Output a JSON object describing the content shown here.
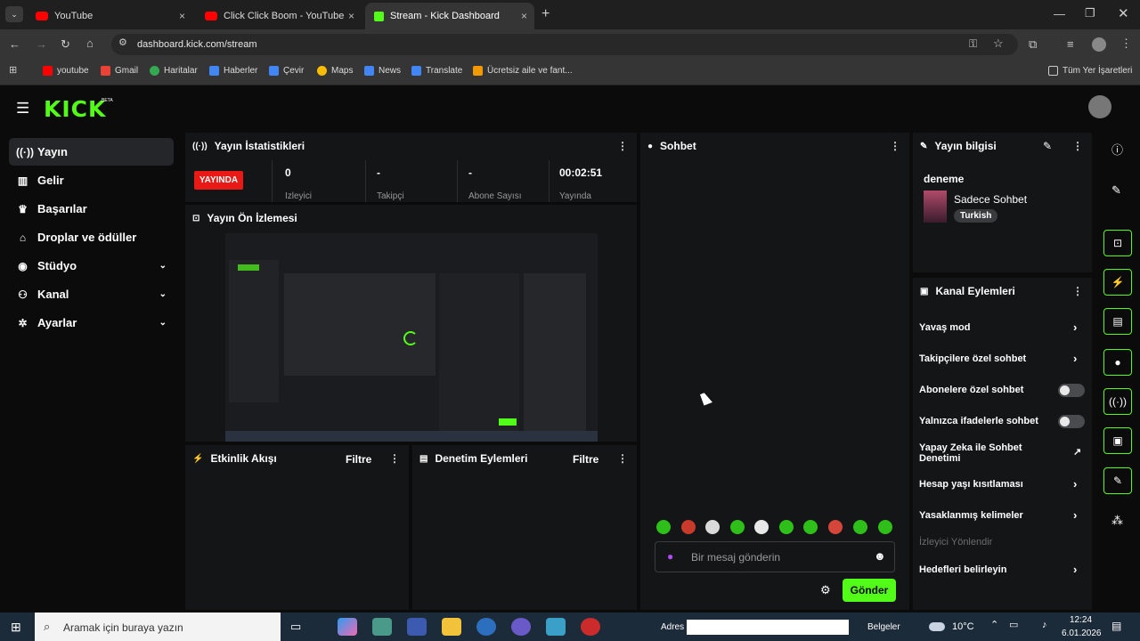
{
  "browser": {
    "tabs": [
      {
        "label": "YouTube",
        "close": "×"
      },
      {
        "label": "Click Click Boom - YouTube",
        "close": "×"
      },
      {
        "label": "Stream - Kick Dashboard",
        "close": "×"
      }
    ],
    "new_tab": "+",
    "url": "dashboard.kick.com/stream",
    "bookmarks": [
      "youtube",
      "Gmail",
      "Haritalar",
      "Haberler",
      "Çevir",
      "Maps",
      "News",
      "Translate",
      "Ücretsiz aile ve fant..."
    ],
    "all_bookmarks": "Tüm Yer İşaretleri"
  },
  "kick": {
    "logo": "KICK",
    "logo_badge": "BETA",
    "sidebar": [
      {
        "label": "Yayın",
        "icon": "broadcast-icon",
        "glyph": "((·))"
      },
      {
        "label": "Gelir",
        "icon": "chart-icon",
        "glyph": "▥"
      },
      {
        "label": "Başarılar",
        "icon": "trophy-icon",
        "glyph": "♛"
      },
      {
        "label": "Droplar ve ödüller",
        "icon": "gift-icon",
        "glyph": "⌂"
      },
      {
        "label": "Stüdyo",
        "icon": "studio-icon",
        "glyph": "◉",
        "chevron": "⌄"
      },
      {
        "label": "Kanal",
        "icon": "channel-icon",
        "glyph": "⚇",
        "chevron": "⌄"
      },
      {
        "label": "Ayarlar",
        "icon": "gear-icon",
        "glyph": "✲",
        "chevron": "⌄"
      }
    ],
    "stats": {
      "title": "Yayın İstatistikleri",
      "live_badge": "YAYINDA",
      "items": [
        {
          "value": "0",
          "label": "İzleyici"
        },
        {
          "value": "-",
          "label": "Takipçi"
        },
        {
          "value": "-",
          "label": "Abone Sayısı"
        },
        {
          "value": "00:02:51",
          "label": "Yayında"
        }
      ]
    },
    "preview": {
      "title": "Yayın Ön İzlemesi"
    },
    "activity": {
      "title": "Etkinlik Akışı",
      "filter": "Filtre"
    },
    "moderation": {
      "title": "Denetim Eylemleri",
      "filter": "Filtre"
    },
    "chat": {
      "title": "Sohbet",
      "placeholder": "Bir mesaj gönderin",
      "send": "Gönder"
    },
    "stream_info": {
      "title": "Yayın bilgisi",
      "stream_title": "deneme",
      "category": "Sadece Sohbet",
      "tag": "Turkish"
    },
    "channel_actions": {
      "title": "Kanal Eylemleri",
      "slow_mode": "Yavaş mod",
      "followers_only": "Takipçilere özel sohbet",
      "subscribers_only": "Abonelere özel sohbet",
      "emotes_only": "Yalnızca ifadelerle sohbet",
      "ai_moderation": "Yapay Zeka ile Sohbet Denetimi",
      "age_restriction": "Hesap yaşı kısıtlaması",
      "banned_words": "Yasaklanmış kelimeler",
      "viewer_redirect": "İzleyici Yönlendir",
      "set_goals": "Hedefleri belirleyin"
    }
  },
  "taskbar": {
    "search_placeholder": "Aramak için buraya yazın",
    "address_label": "Adres",
    "documents": "Belgeler",
    "weather": "10°C",
    "time": "12:24",
    "date": "6.01.2026"
  },
  "colors": {
    "accent": "#53fc18",
    "live": "#e91916",
    "bg": "#0b0b0c",
    "panel": "#141517"
  }
}
